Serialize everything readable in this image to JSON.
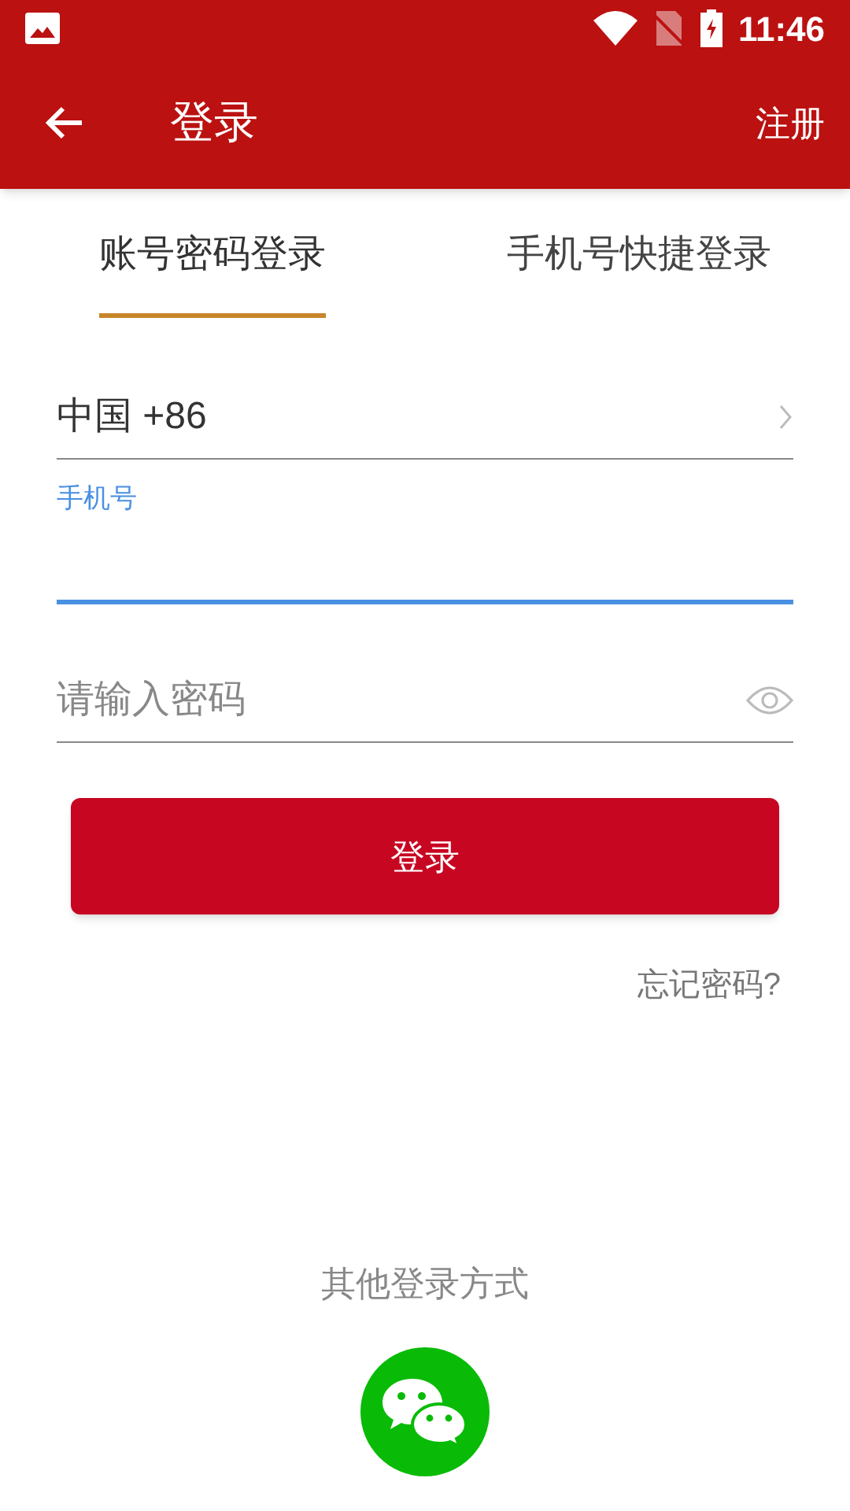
{
  "status_bar": {
    "time": "11:46"
  },
  "app_bar": {
    "title": "登录",
    "action": "注册"
  },
  "tabs": [
    {
      "label": "账号密码登录",
      "selected": true
    },
    {
      "label": "手机号快捷登录",
      "selected": false
    }
  ],
  "country": {
    "value": "中国 +86"
  },
  "phone_field": {
    "label": "手机号",
    "focused": true
  },
  "password_field": {
    "placeholder": "请输入密码"
  },
  "login_button": "登录",
  "forgot_link": "忘记密码?",
  "other_login": {
    "label": "其他登录方式"
  }
}
